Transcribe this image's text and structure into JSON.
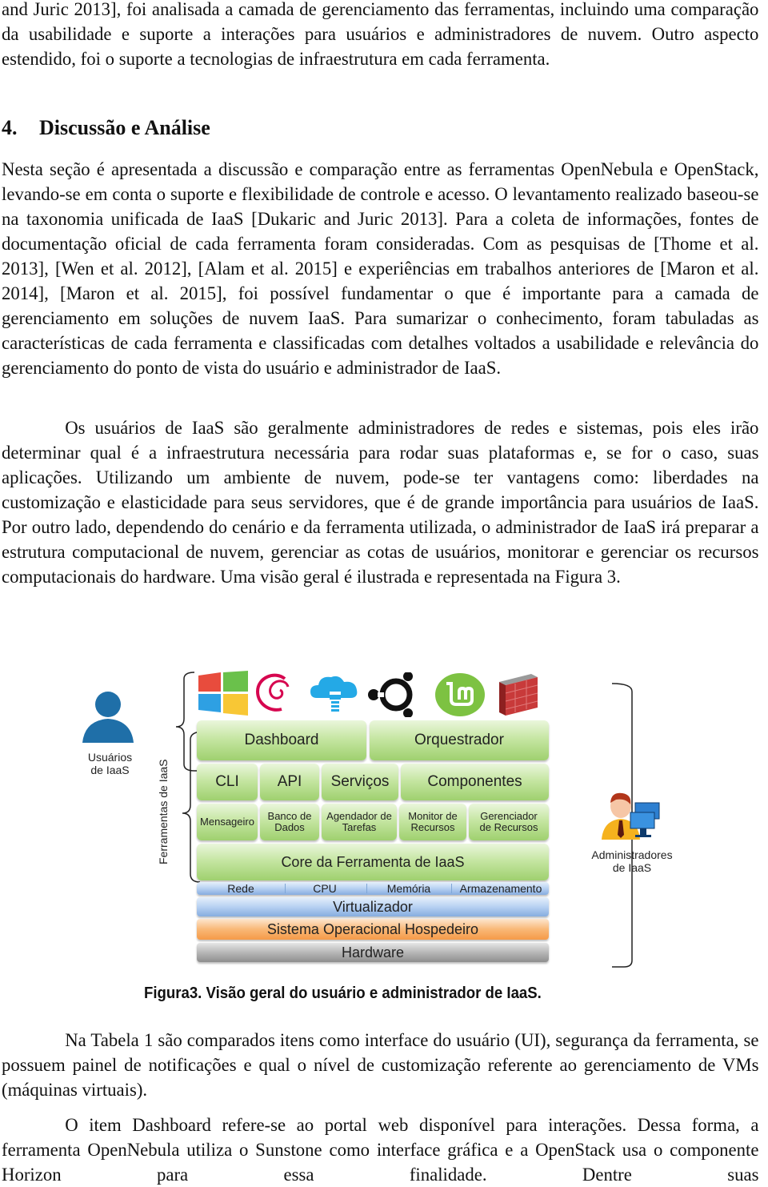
{
  "page": {
    "paragraphs": [
      {
        "id": "intro-continuation",
        "text": "and Juric 2013], foi analisada a camada de gerenciamento das ferramentas, incluindo uma comparação da usabilidade e suporte a interações para usuários e administradores de nuvem. Outro aspecto estendido, foi o suporte a tecnologias de infraestrutura em cada ferramenta."
      },
      {
        "id": "section4-p1",
        "text": "Nesta seção é apresentada a discussão e comparação entre as ferramentas OpenNebula e OpenStack, levando-se em conta o suporte e flexibilidade de controle e acesso. O levantamento realizado baseou-se na taxonomia unificada de IaaS [Dukaric and Juric 2013]. Para a coleta de informações, fontes de documentação oficial de cada ferramenta foram consideradas. Com as pesquisas de [Thome et al. 2013], [Wen et al. 2012], [Alam et al. 2015] e experiências em trabalhos anteriores de [Maron et al. 2014], [Maron et al. 2015], foi possível fundamentar o que é importante para a camada de gerenciamento em soluções de nuvem IaaS. Para sumarizar o conhecimento, foram tabuladas as características de cada ferramenta e classificadas com detalhes voltados a usabilidade e relevância do gerenciamento do ponto de vista do usuário e administrador de IaaS."
      },
      {
        "id": "section4-p2",
        "text": "Os usuários de IaaS são geralmente administradores de redes e sistemas, pois eles irão determinar qual é a infraestrutura necessária para rodar suas plataformas e, se for o caso, suas aplicações. Utilizando um ambiente de nuvem, pode-se ter vantagens como: liberdades na customização e elasticidade para seus servidores, que é de grande importância para usuários de IaaS. Por outro lado, dependendo do cenário e da ferramenta utilizada, o administrador de IaaS irá preparar a estrutura computacional de nuvem, gerenciar as cotas de usuários, monitorar e gerenciar os recursos computacionais do hardware. Uma visão geral é ilustrada e representada na Figura 3."
      },
      {
        "id": "section4-p3",
        "text": "Na Tabela 1 são comparados itens como interface do usuário (UI), segurança da ferramenta, se possuem painel de notificações e qual o nível de customização referente ao gerenciamento de VMs (máquinas virtuais)."
      },
      {
        "id": "section4-p4",
        "text": "O item Dashboard refere-se ao portal web disponível para interações. Dessa forma, a ferramenta OpenNebula utiliza o Sunstone como interface gráfica e a OpenStack usa o componente Horizon para essa finalidade. Dentre suas"
      }
    ],
    "section_heading": {
      "number": "4.",
      "title": "Discussão e Análise"
    },
    "figure": {
      "caption": "Figura3. Visão geral do usuário e administrador de IaaS.",
      "os_icons": [
        "windows-logo-icon",
        "debian-logo-icon",
        "cloud-upload-icon",
        "ubuntu-logo-icon",
        "linux-mint-logo-icon",
        "firewall-icon"
      ],
      "left_actor": {
        "icon": "user-icon",
        "label_line1": "Usuários",
        "label_line2": "de IaaS"
      },
      "right_actor": {
        "icon": "admin-computer-icon",
        "label_line1": "Administradores",
        "label_line2": "de IaaS"
      },
      "tools_bracket_label": "Ferramentas de IaaS",
      "rows": {
        "row1": [
          "Dashboard",
          "Orquestrador"
        ],
        "row2": [
          "CLI",
          "API",
          "Serviços",
          "Componentes"
        ],
        "row3": [
          {
            "line1": "Mensageiro",
            "line2": ""
          },
          {
            "line1": "Banco de",
            "line2": "Dados"
          },
          {
            "line1": "Agendador de",
            "line2": "Tarefas"
          },
          {
            "line1": "Monitor de",
            "line2": "Recursos"
          },
          {
            "line1": "Gerenciador",
            "line2": "de Recursos"
          }
        ],
        "core": "Core da Ferramenta de IaaS",
        "resources": [
          "Rede",
          "CPU",
          "Memória",
          "Armazenamento"
        ],
        "virtualizer": "Virtualizador",
        "host_os": "Sistema Operacional Hospedeiro",
        "hardware": "Hardware"
      },
      "colors": {
        "tool_layers": "#b4dd8a",
        "virtualization_layers": "#9fbfe9",
        "host_os_layer": "#f7a95c",
        "hardware_layer": "#a9a9a9",
        "user_icon": "#1f6fa8"
      }
    }
  }
}
